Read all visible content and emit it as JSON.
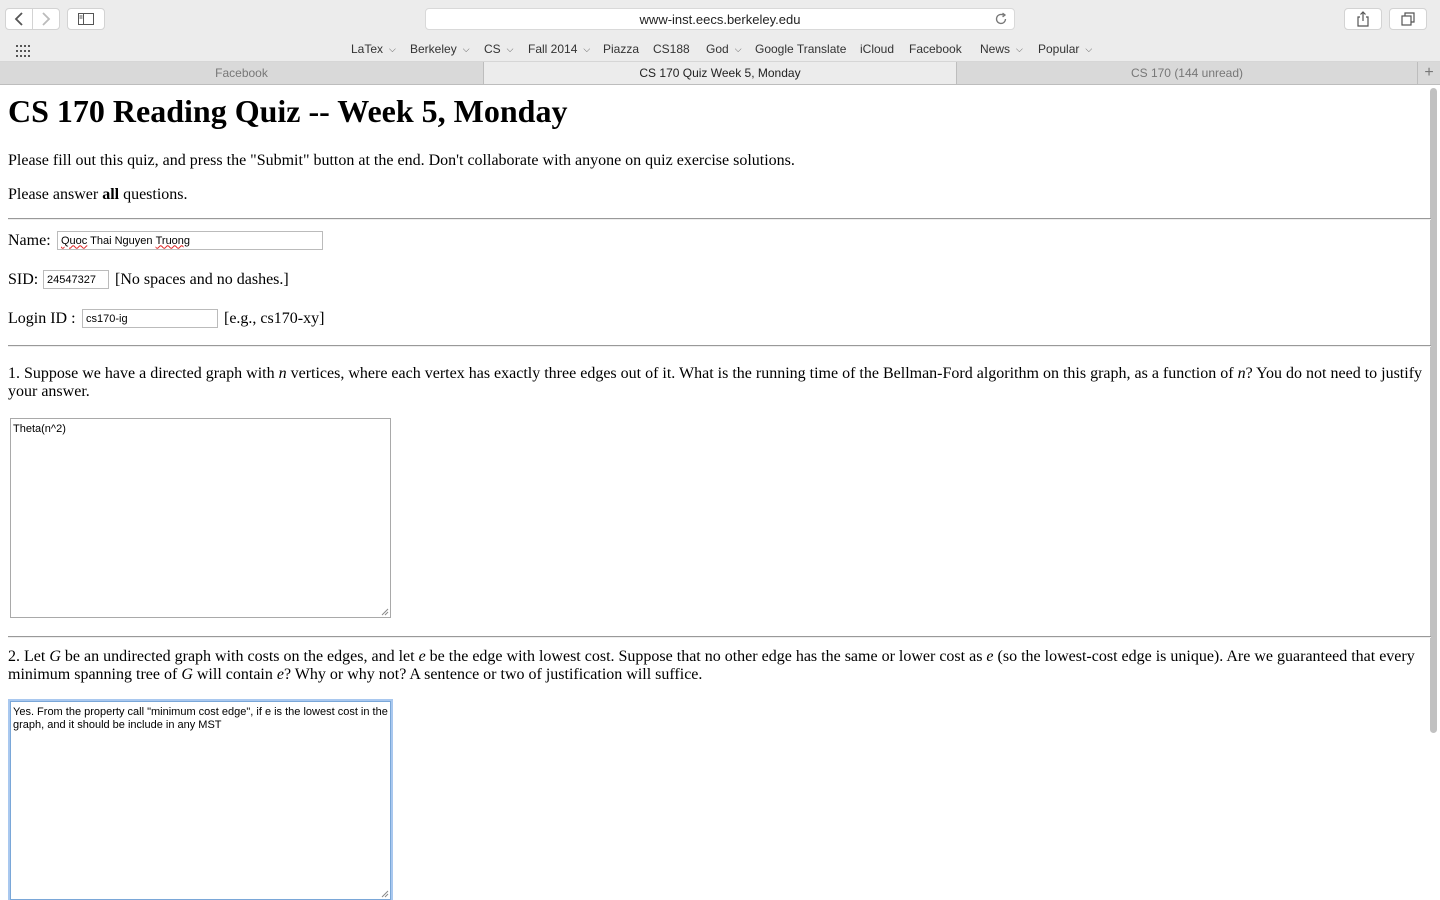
{
  "browser": {
    "url": "www-inst.eecs.berkeley.edu",
    "bookmarks": [
      {
        "label": "LaTex",
        "menu": true
      },
      {
        "label": "Berkeley",
        "menu": true
      },
      {
        "label": "CS",
        "menu": true
      },
      {
        "label": "Fall 2014",
        "menu": true
      },
      {
        "label": "Piazza",
        "menu": false
      },
      {
        "label": "CS188",
        "menu": false
      },
      {
        "label": "God",
        "menu": true
      },
      {
        "label": "Google Translate",
        "menu": false
      },
      {
        "label": "iCloud",
        "menu": false
      },
      {
        "label": "Facebook",
        "menu": false
      },
      {
        "label": "News",
        "menu": true
      },
      {
        "label": "Popular",
        "menu": true
      }
    ],
    "tabs": [
      {
        "label": "Facebook",
        "active": false
      },
      {
        "label": "CS 170 Quiz Week 5, Monday",
        "active": true
      },
      {
        "label": "CS 170 (144 unread)",
        "active": false
      }
    ]
  },
  "page": {
    "title": "CS 170 Reading Quiz -- Week 5, Monday",
    "intro": "Please fill out this quiz, and press the \"Submit\" button at the end. Don't collaborate with anyone on quiz exercise solutions.",
    "answer_all_pre": "Please answer ",
    "answer_all_bold": "all",
    "answer_all_post": " questions.",
    "name_label": "Name:",
    "name_value_word1": "Quoc",
    "name_value_mid": " Thai Nguyen ",
    "name_value_word2": "Truong",
    "sid_label": "SID:",
    "sid_value": "24547327",
    "sid_hint": "[No spaces and no dashes.]",
    "login_label": "Login ID :",
    "login_value": "cs170-ig",
    "login_hint": "[e.g., cs170-xy]",
    "q1": {
      "t1": "1. Suppose we have a directed graph with ",
      "n1": "n",
      "t2": " vertices, where each vertex has exactly three edges out of it. What is the running time of the Bellman-Ford algorithm on this graph, as a function of ",
      "n2": "n",
      "t3": "? You do not need to justify your answer.",
      "answer": "Theta(n^2)"
    },
    "q2": {
      "t1": "2. Let ",
      "g1": "G",
      "t2": " be an undirected graph with costs on the edges, and let ",
      "e1": "e",
      "t3": " be the edge with lowest cost. Suppose that no other edge has the same or lower cost as ",
      "e2": "e",
      "t4": " (so the lowest-cost edge is unique). Are we guaranteed that every minimum spanning tree of ",
      "g2": "G",
      "t5": " will contain ",
      "e3": "e",
      "t6": "? Why or why not? A sentence or two of justification will suffice.",
      "answer": "Yes. From the property call \"minimum cost edge\", if e is the lowest cost in the graph, and it should be include in any MST"
    }
  }
}
